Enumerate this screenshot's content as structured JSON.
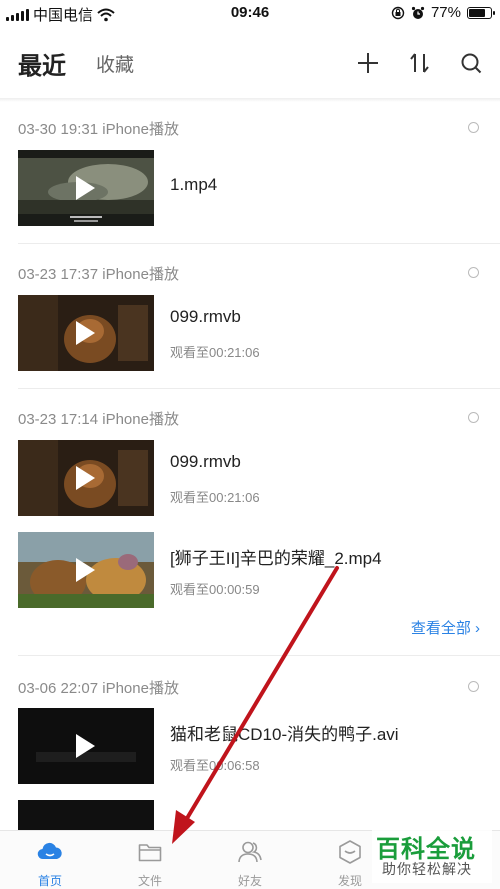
{
  "status_bar": {
    "carrier": "中国电信",
    "time": "09:46",
    "battery_percent": "77%",
    "battery_level": 0.77,
    "icons": [
      "signal-icon",
      "wifi-icon",
      "orientation-lock-icon",
      "alarm-icon",
      "battery-icon"
    ]
  },
  "header": {
    "tab_recent": "最近",
    "tab_favorites": "收藏",
    "icons": [
      "plus-icon",
      "sort-icon",
      "search-icon"
    ]
  },
  "groups": [
    {
      "header": "03-30 19:31 iPhone播放",
      "items": [
        {
          "title": "1.mp4",
          "progress": ""
        }
      ]
    },
    {
      "header": "03-23 17:37 iPhone播放",
      "items": [
        {
          "title": "099.rmvb",
          "progress": "观看至00:21:06"
        }
      ]
    },
    {
      "header": "03-23 17:14 iPhone播放",
      "items": [
        {
          "title": "099.rmvb",
          "progress": "观看至00:21:06"
        },
        {
          "title": "[狮子王II]辛巴的荣耀_2.mp4",
          "progress": "观看至00:00:59"
        }
      ],
      "see_all": "查看全部 ›"
    },
    {
      "header": "03-06 22:07 iPhone播放",
      "items": [
        {
          "title": "猫和老鼠CD10-消失的鸭子.avi",
          "progress": "观看至00:06:58"
        }
      ]
    }
  ],
  "bottom_nav": {
    "items": [
      {
        "label": "首页",
        "icon": "cloud-icon",
        "active": true
      },
      {
        "label": "文件",
        "icon": "folder-icon",
        "active": false
      },
      {
        "label": "好友",
        "icon": "friends-icon",
        "active": false
      },
      {
        "label": "发现",
        "icon": "discover-icon",
        "active": false
      }
    ]
  },
  "watermark": {
    "main": "百科全说",
    "sub": "助你轻松解决"
  },
  "colors": {
    "accent": "#2a82e4",
    "annotation_arrow": "#c0141c",
    "watermark_green": "#1a9d3b"
  }
}
